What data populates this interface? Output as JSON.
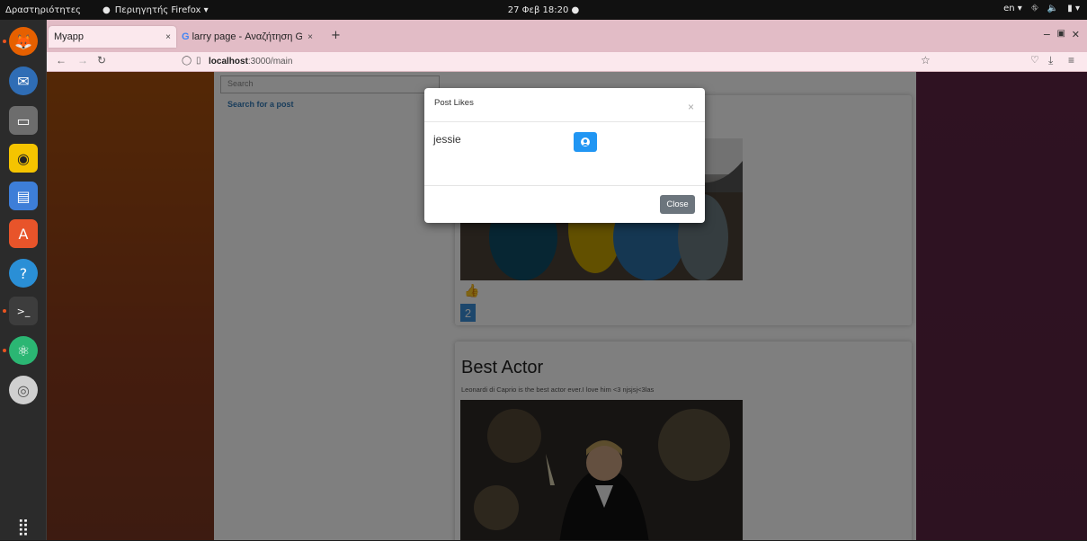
{
  "topbar": {
    "activities": "Δραστηριότητες",
    "app_menu": "Περιηγητής Firefox ▾",
    "clock": "27 Φεβ 18:20",
    "lang": "en ▾"
  },
  "browser": {
    "tabs": [
      {
        "label": "Myapp"
      },
      {
        "label": "larry page - Αναζήτηση G"
      }
    ],
    "url_host": "localhost",
    "url_path": ":3000/main"
  },
  "page": {
    "search_placeholder": "Search",
    "search_link": "Search for a post",
    "post1": {
      "likes": "2"
    },
    "post2": {
      "title": "Best Actor",
      "text": "Leonardi di Caprio is the best actor ever.I love him <3 njsjsj<3las"
    }
  },
  "modal": {
    "title": "Post Likes",
    "close_x": "×",
    "users": [
      "jessie"
    ],
    "close_label": "Close"
  }
}
